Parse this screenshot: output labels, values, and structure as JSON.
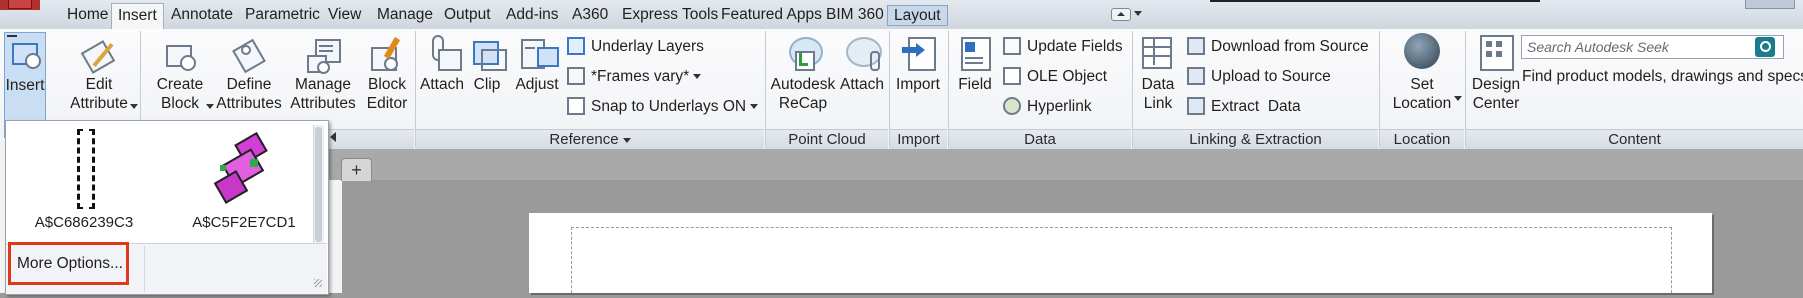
{
  "tabs": [
    {
      "label": "Home"
    },
    {
      "label": "Insert",
      "active": true
    },
    {
      "label": "Annotate"
    },
    {
      "label": "Parametric"
    },
    {
      "label": "View"
    },
    {
      "label": "Manage"
    },
    {
      "label": "Output"
    },
    {
      "label": "Add-ins"
    },
    {
      "label": "A360"
    },
    {
      "label": "Express Tools"
    },
    {
      "label": "Featured Apps"
    },
    {
      "label": "BIM 360"
    },
    {
      "label": "Layout"
    }
  ],
  "block": {
    "insert": "Insert",
    "edit_attribute_1": "Edit",
    "edit_attribute_2": "Attribute",
    "create_block_1": "Create",
    "create_block_2": "Block",
    "define_attributes_1": "Define",
    "define_attributes_2": "Attributes",
    "manage_attributes_1": "Manage",
    "manage_attributes_2": "Attributes",
    "block_editor_1": "Block",
    "block_editor_2": "Editor"
  },
  "reference": {
    "attach": "Attach",
    "clip": "Clip",
    "adjust": "Adjust",
    "underlay_layers": "Underlay Layers",
    "frames_vary": "*Frames vary*",
    "snap_to_underlays": "Snap to Underlays ON",
    "panel_title": "Reference"
  },
  "point_cloud": {
    "recap_1": "Autodesk",
    "recap_2": "ReCap",
    "attach": "Attach",
    "panel_title": "Point Cloud"
  },
  "import": {
    "import": "Import",
    "panel_title": "Import"
  },
  "data": {
    "field": "Field",
    "update_fields": "Update Fields",
    "ole_object": "OLE Object",
    "hyperlink": "Hyperlink",
    "panel_title": "Data"
  },
  "linking": {
    "data_link_1": "Data",
    "data_link_2": "Link",
    "download_from_source": "Download from Source",
    "upload_to_source": "Upload to Source",
    "extract_data": "Extract  Data",
    "panel_title": "Linking & Extraction"
  },
  "location": {
    "set_location_1": "Set",
    "set_location_2": "Location",
    "panel_title": "Location"
  },
  "content": {
    "design_center_1": "Design",
    "design_center_2": "Center",
    "search_placeholder": "Search Autodesk Seek",
    "find_text": "Find product models, drawings and specs",
    "panel_title": "Content"
  },
  "gallery": {
    "items": [
      {
        "label": "A$C686239C3"
      },
      {
        "label": "A$C5F2E7CD1"
      }
    ],
    "more_options": "More Options..."
  },
  "doc_tabs": {
    "new_tab": "+"
  },
  "colors": {
    "highlight_border": "#e0381b",
    "ribbon_bg": "#f0f2f5",
    "pressed_button": "#c9ddf3",
    "drawing_bg": "#9a9a9a"
  }
}
